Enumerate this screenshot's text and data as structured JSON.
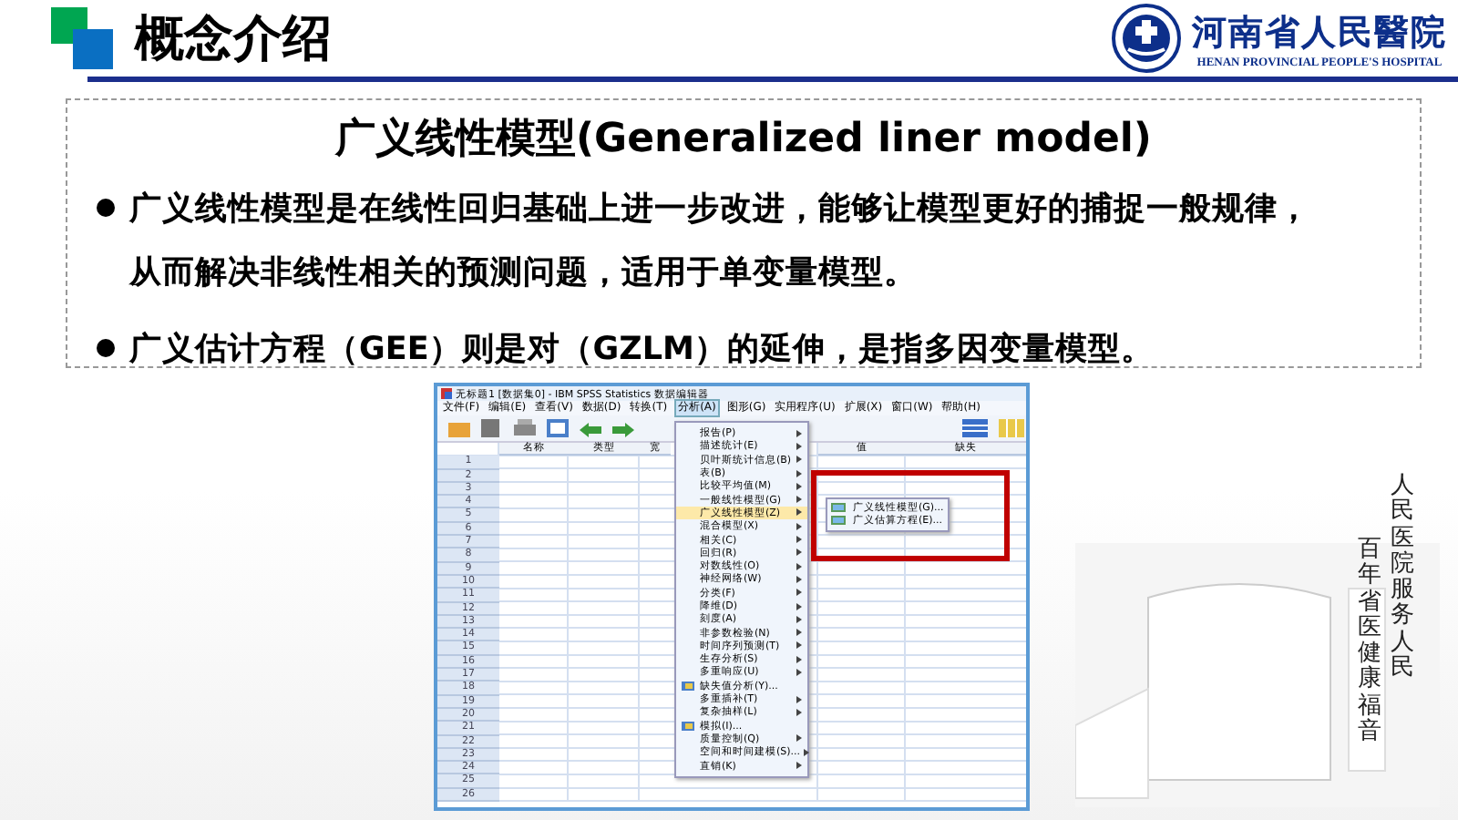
{
  "header": {
    "title": "概念介绍",
    "logo_name": "河南省人民醫院",
    "logo_subtitle": "HENAN PROVINCIAL PEOPLE'S HOSPITAL"
  },
  "concept": {
    "heading": "广义线性模型(Generalized liner model)",
    "bullets": [
      {
        "text": "广义线性模型是在线性回归基础上进一步改进，能够让模型更好的捕捉一般规律，从而解决非线性相关的预测问题，适用于单变量模型。"
      },
      {
        "text": "广义估计方程（GEE）则是对（GZLM）的延伸，是指多因变量模型。"
      }
    ]
  },
  "spss_window": {
    "title": "无标题1 [数据集0] - IBM SPSS Statistics 数据编辑器",
    "menubar": [
      {
        "label": "文件(F)",
        "selected": false
      },
      {
        "label": "编辑(E)",
        "selected": false
      },
      {
        "label": "查看(V)",
        "selected": false
      },
      {
        "label": "数据(D)",
        "selected": false
      },
      {
        "label": "转换(T)",
        "selected": false
      },
      {
        "label": "分析(A)",
        "selected": true
      },
      {
        "label": "图形(G)",
        "selected": false
      },
      {
        "label": "实用程序(U)",
        "selected": false
      },
      {
        "label": "扩展(X)",
        "selected": false
      },
      {
        "label": "窗口(W)",
        "selected": false
      },
      {
        "label": "帮助(H)",
        "selected": false
      }
    ],
    "columns_left": [
      "名称",
      "类型",
      "宽"
    ],
    "columns_right": [
      "值",
      "缺失"
    ],
    "row_numbers": [
      "1",
      "2",
      "3",
      "4",
      "5",
      "6",
      "7",
      "8",
      "9",
      "10",
      "11",
      "12",
      "13",
      "14",
      "15",
      "16",
      "17",
      "18",
      "19",
      "20",
      "21",
      "22",
      "23",
      "24",
      "25",
      "26"
    ],
    "analyze_menu": [
      {
        "label": "报告(P)",
        "has_submenu": true,
        "has_icon": false,
        "selected": false
      },
      {
        "label": "描述统计(E)",
        "has_submenu": true,
        "has_icon": false,
        "selected": false
      },
      {
        "label": "贝叶斯统计信息(B)",
        "has_submenu": true,
        "has_icon": false,
        "selected": false
      },
      {
        "label": "表(B)",
        "has_submenu": true,
        "has_icon": false,
        "selected": false
      },
      {
        "label": "比较平均值(M)",
        "has_submenu": true,
        "has_icon": false,
        "selected": false
      },
      {
        "label": "一般线性模型(G)",
        "has_submenu": true,
        "has_icon": false,
        "selected": false
      },
      {
        "label": "广义线性模型(Z)",
        "has_submenu": true,
        "has_icon": false,
        "selected": true
      },
      {
        "label": "混合模型(X)",
        "has_submenu": true,
        "has_icon": false,
        "selected": false
      },
      {
        "label": "相关(C)",
        "has_submenu": true,
        "has_icon": false,
        "selected": false
      },
      {
        "label": "回归(R)",
        "has_submenu": true,
        "has_icon": false,
        "selected": false
      },
      {
        "label": "对数线性(O)",
        "has_submenu": true,
        "has_icon": false,
        "selected": false
      },
      {
        "label": "神经网络(W)",
        "has_submenu": true,
        "has_icon": false,
        "selected": false
      },
      {
        "label": "分类(F)",
        "has_submenu": true,
        "has_icon": false,
        "selected": false
      },
      {
        "label": "降维(D)",
        "has_submenu": true,
        "has_icon": false,
        "selected": false
      },
      {
        "label": "刻度(A)",
        "has_submenu": true,
        "has_icon": false,
        "selected": false
      },
      {
        "label": "非参数检验(N)",
        "has_submenu": true,
        "has_icon": false,
        "selected": false
      },
      {
        "label": "时间序列预测(T)",
        "has_submenu": true,
        "has_icon": false,
        "selected": false
      },
      {
        "label": "生存分析(S)",
        "has_submenu": true,
        "has_icon": false,
        "selected": false
      },
      {
        "label": "多重响应(U)",
        "has_submenu": true,
        "has_icon": false,
        "selected": false
      },
      {
        "label": "缺失值分析(Y)...",
        "has_submenu": false,
        "has_icon": true,
        "selected": false
      },
      {
        "label": "多重插补(T)",
        "has_submenu": true,
        "has_icon": false,
        "selected": false
      },
      {
        "label": "复杂抽样(L)",
        "has_submenu": true,
        "has_icon": false,
        "selected": false
      },
      {
        "label": "模拟(I)...",
        "has_submenu": false,
        "has_icon": true,
        "selected": false
      },
      {
        "label": "质量控制(Q)",
        "has_submenu": true,
        "has_icon": false,
        "selected": false
      },
      {
        "label": "空间和时间建模(S)...",
        "has_submenu": true,
        "has_icon": false,
        "selected": false
      },
      {
        "label": "直销(K)",
        "has_submenu": true,
        "has_icon": false,
        "selected": false
      }
    ],
    "submenu": [
      {
        "label": "广义线性模型(G)...",
        "has_icon": true
      },
      {
        "label": "广义估算方程(E)...",
        "has_icon": true
      }
    ],
    "highlight": true
  },
  "motto": {
    "columns": [
      "人民医院服务人民",
      "百年省医健康福音"
    ]
  }
}
